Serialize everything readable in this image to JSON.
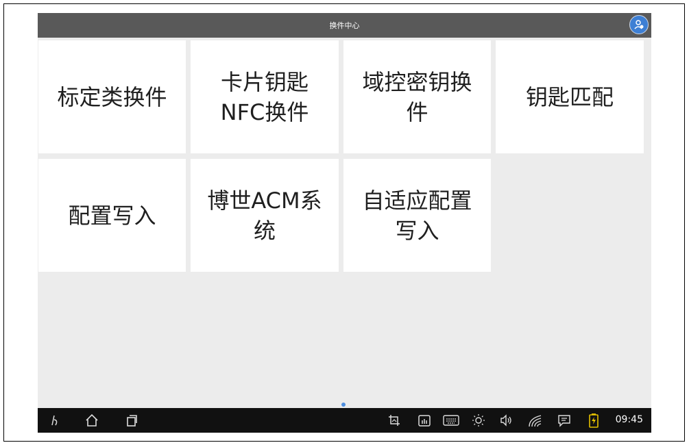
{
  "app": {
    "title": "换件中心"
  },
  "tiles": [
    {
      "label": "标定类换件"
    },
    {
      "label": "卡片钥匙NFC换件"
    },
    {
      "label": "域控密钥换件"
    },
    {
      "label": "钥匙匹配"
    },
    {
      "label": "配置写入"
    },
    {
      "label": "博世ACM系统"
    },
    {
      "label": "自适应配置写入"
    }
  ],
  "status_bar": {
    "time": "09:45"
  },
  "colors": {
    "titlebar": "#595959",
    "navbar": "#111111",
    "background": "#ececec",
    "tile": "#ffffff",
    "accent": "#3d7fd4",
    "battery": "#e6c200"
  },
  "icons": {
    "avatar": "user-avatar-icon",
    "nav": [
      "back-gesture-icon",
      "home-icon",
      "recent-apps-icon",
      "screenshot-icon",
      "screen-record-icon",
      "keyboard-icon",
      "brightness-icon",
      "volume-icon",
      "wifi-icon",
      "message-icon",
      "battery-icon"
    ]
  }
}
